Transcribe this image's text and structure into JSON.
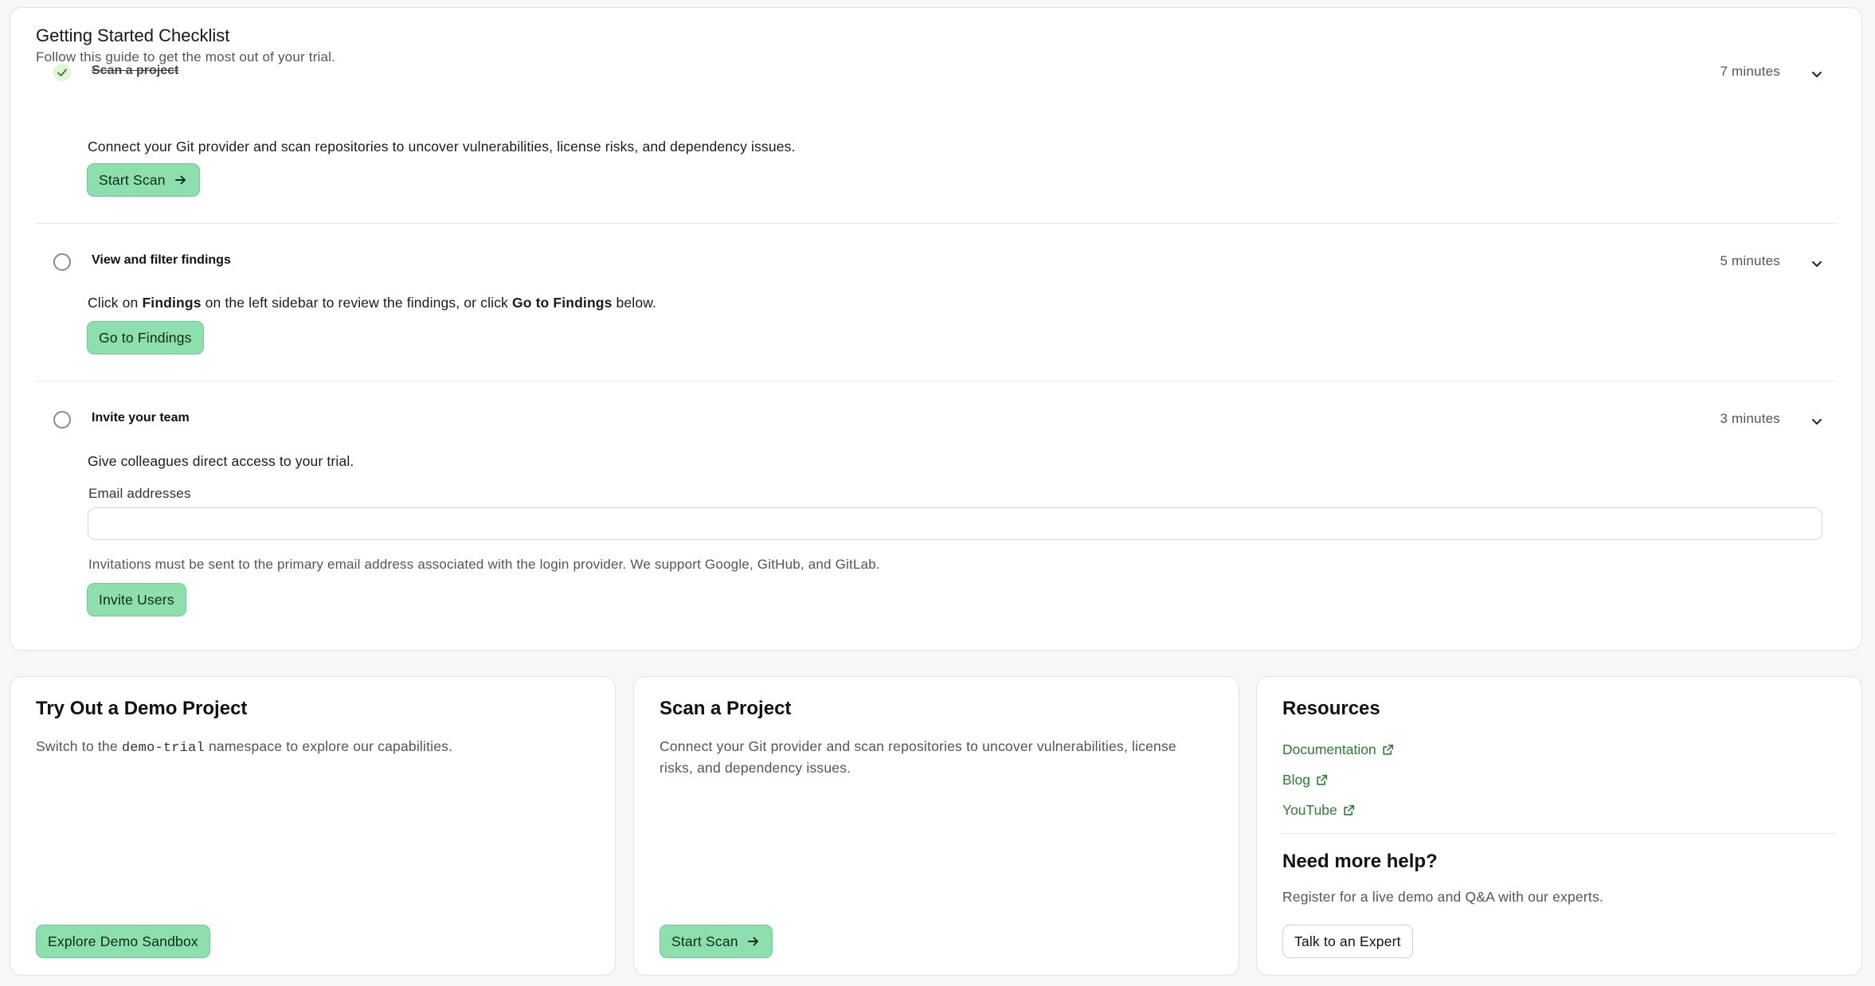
{
  "checklist": {
    "title": "Getting Started Checklist",
    "subtitle": "Follow this guide to get the most out of your trial.",
    "items": [
      {
        "title": "Scan a project",
        "completed": true,
        "time": "7 minutes",
        "description": "Connect your Git provider and scan repositories to uncover vulnerabilities, license risks, and dependency issues.",
        "button": "Start Scan"
      },
      {
        "title": "View and filter findings",
        "completed": false,
        "time": "5 minutes",
        "description": {
          "part1": "Click on ",
          "bold1": "Findings",
          "part2": " on the left sidebar to review the findings, or click ",
          "bold2": "Go to Findings",
          "part3": " below."
        },
        "button": "Go to Findings"
      },
      {
        "title": "Invite your team",
        "completed": false,
        "time": "3 minutes",
        "description": "Give colleagues direct access to your trial.",
        "email_label": "Email addresses",
        "email_value": "",
        "hint": "Invitations must be sent to the primary email address associated with the login provider. We support Google, GitHub, and GitLab.",
        "button": "Invite Users"
      }
    ]
  },
  "demo": {
    "title": "Try Out a Demo Project",
    "text_before": "Switch to the ",
    "namespace": "demo-trial",
    "text_after": " namespace to explore our capabilities.",
    "button": "Explore Demo Sandbox"
  },
  "scan": {
    "title": "Scan a Project",
    "line1": "Connect your Git provider and scan repositories to uncover vulnerabilities, license",
    "line2": "risks, and dependency issues.",
    "button": "Start Scan"
  },
  "resources": {
    "title": "Resources",
    "links": [
      "Documentation",
      "Blog",
      "YouTube"
    ],
    "help_title": "Need more help?",
    "help_text": "Register for a live demo and Q&A with our experts.",
    "help_button": "Talk to an Expert"
  },
  "colors": {
    "accent_button": "#8de0ad",
    "link": "#2e7d32",
    "check_bg": "#e2f5d8"
  },
  "icons": {
    "check": "check-icon",
    "chevron": "chevron-down-icon",
    "arrow": "arrow-right-icon",
    "external": "external-link-icon"
  }
}
